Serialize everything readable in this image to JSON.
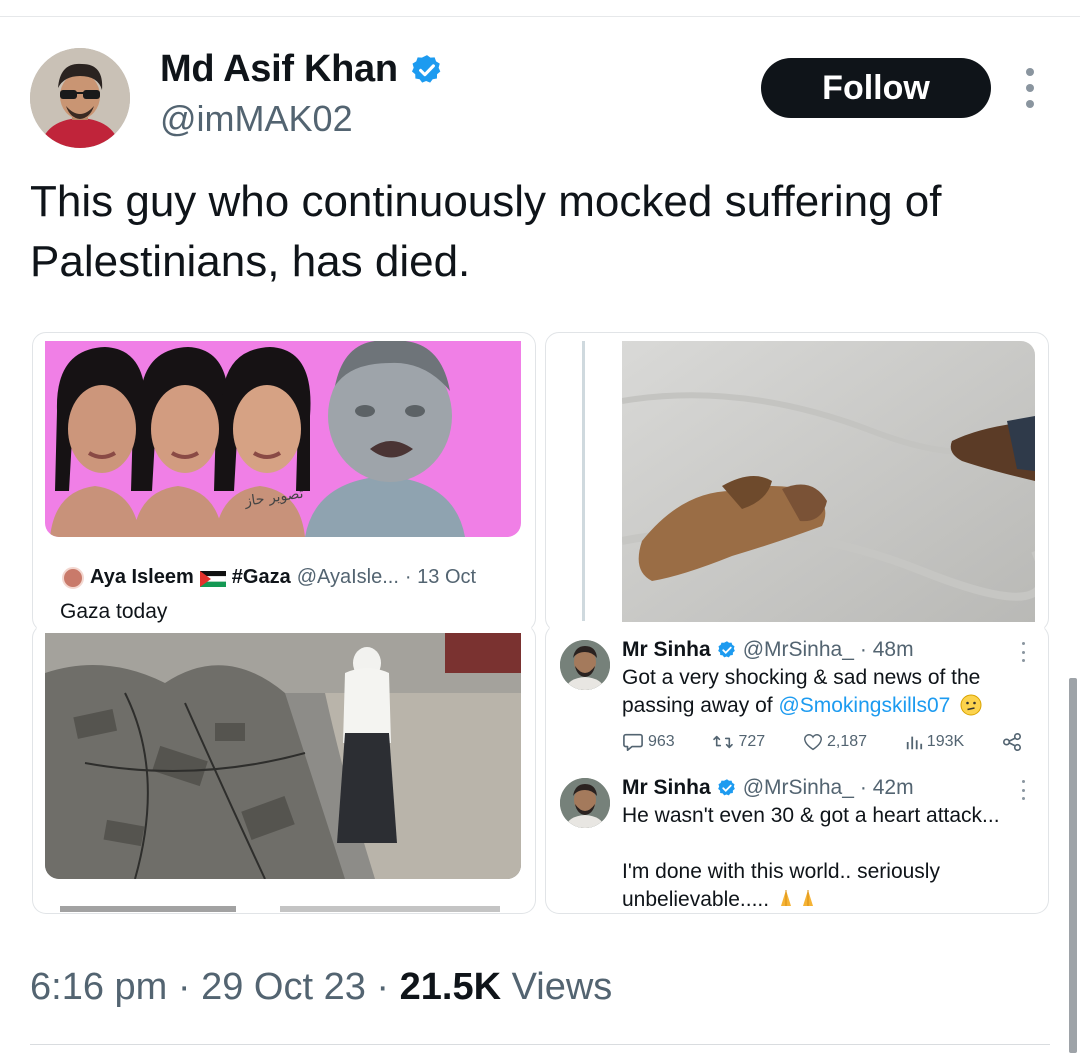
{
  "author": {
    "display_name": "Md Asif Khan",
    "handle": "@imMAK02",
    "verified_icon": "verified-badge-icon",
    "follow_label": "Follow"
  },
  "tweet": {
    "text": "This guy who continuously mocked suffering of Palestinians, has died."
  },
  "quoted_post": {
    "author_name": "Aya Isleem",
    "hashtag": "#Gaza",
    "handle": "@AyaIsle...",
    "date": "· 13 Oct",
    "text": "Gaza today",
    "image_caption": "تصوير حاز"
  },
  "reply_posts": [
    {
      "name": "Mr Sinha",
      "handle": "@MrSinha_",
      "time": "· 48m",
      "text_before_mention": "Got a very shocking  & sad news of the passing away of ",
      "mention": "@Smokingskills07",
      "stats": {
        "replies": "963",
        "reposts": "727",
        "likes": "2,187",
        "views": "193K"
      }
    },
    {
      "name": "Mr Sinha",
      "handle": "@MrSinha_",
      "time": "· 42m",
      "line1": "He wasn't even 30 & got a heart attack...",
      "line2": "I'm done with this world.. seriously",
      "line3": "unbelievable....."
    }
  ],
  "footer": {
    "time": "6:16 pm",
    "separator": "·",
    "date": "29 Oct 23",
    "views_count": "21.5K",
    "views_label": "Views"
  },
  "colors": {
    "text": "#0f1419",
    "muted": "#536471",
    "accent": "#1d9bf0",
    "follow_bg": "#0f1419",
    "pink_bg": "#f07fe6"
  }
}
